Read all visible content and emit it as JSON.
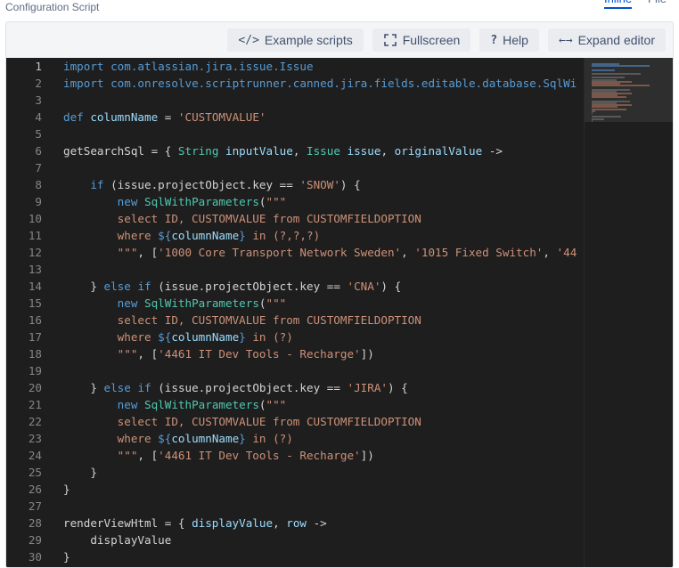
{
  "header": {
    "title": "Configuration Script",
    "tabs": [
      {
        "label": "Inline",
        "active": true
      },
      {
        "label": "File",
        "active": false
      }
    ]
  },
  "toolbar": {
    "example_scripts": "Example scripts",
    "fullscreen": "Fullscreen",
    "help": "Help",
    "expand_editor": "Expand editor"
  },
  "editor": {
    "current_line": 1,
    "colors": {
      "background": "#1e1e1e",
      "keyword": "#569cd6",
      "type": "#4ec9b0",
      "string": "#ce9178",
      "identifier": "#9cdcfe",
      "text": "#d4d4d4",
      "line_number": "#858585"
    },
    "lines": [
      {
        "n": "1",
        "tokens": [
          [
            "kw",
            "import"
          ],
          [
            "pun",
            " "
          ],
          [
            "kw",
            "com.atlassian.jira.issue.Issue"
          ]
        ]
      },
      {
        "n": "2",
        "tokens": [
          [
            "kw",
            "import"
          ],
          [
            "pun",
            " "
          ],
          [
            "kw",
            "com.onresolve.scriptrunner.canned.jira.fields.editable.database.SqlWi"
          ]
        ]
      },
      {
        "n": "3",
        "tokens": []
      },
      {
        "n": "4",
        "tokens": [
          [
            "kw",
            "def"
          ],
          [
            "pun",
            " "
          ],
          [
            "id",
            "columnName"
          ],
          [
            "pun",
            " = "
          ],
          [
            "str",
            "'CUSTOMVALUE'"
          ]
        ]
      },
      {
        "n": "5",
        "tokens": []
      },
      {
        "n": "6",
        "tokens": [
          [
            "pun",
            "getSearchSql = { "
          ],
          [
            "ty",
            "String"
          ],
          [
            "pun",
            " "
          ],
          [
            "id",
            "inputValue"
          ],
          [
            "pun",
            ", "
          ],
          [
            "ty",
            "Issue"
          ],
          [
            "pun",
            " "
          ],
          [
            "id",
            "issue"
          ],
          [
            "pun",
            ", "
          ],
          [
            "id",
            "originalValue"
          ],
          [
            "pun",
            " ->"
          ]
        ]
      },
      {
        "n": "7",
        "tokens": []
      },
      {
        "n": "8",
        "tokens": [
          [
            "pun",
            "    "
          ],
          [
            "kw",
            "if"
          ],
          [
            "pun",
            " (issue.projectObject.key == "
          ],
          [
            "str",
            "'SNOW'"
          ],
          [
            "pun",
            ") {"
          ]
        ]
      },
      {
        "n": "9",
        "tokens": [
          [
            "pun",
            "        "
          ],
          [
            "kw",
            "new"
          ],
          [
            "pun",
            " "
          ],
          [
            "ty",
            "SqlWithParameters"
          ],
          [
            "pun",
            "("
          ],
          [
            "str",
            "\"\"\""
          ]
        ]
      },
      {
        "n": "10",
        "tokens": [
          [
            "str",
            "        select ID, CUSTOMVALUE from CUSTOMFIELDOPTION"
          ]
        ]
      },
      {
        "n": "11",
        "tokens": [
          [
            "str",
            "        where "
          ],
          [
            "kw",
            "${"
          ],
          [
            "id",
            "columnName"
          ],
          [
            "kw",
            "}"
          ],
          [
            "str",
            " in (?,?,?)"
          ]
        ]
      },
      {
        "n": "12",
        "tokens": [
          [
            "str",
            "        \"\"\""
          ],
          [
            "pun",
            ", ["
          ],
          [
            "str",
            "'1000 Core Transport Network Sweden'"
          ],
          [
            "pun",
            ", "
          ],
          [
            "str",
            "'1015 Fixed Switch'"
          ],
          [
            "pun",
            ", "
          ],
          [
            "str",
            "'44"
          ]
        ]
      },
      {
        "n": "13",
        "tokens": []
      },
      {
        "n": "14",
        "tokens": [
          [
            "pun",
            "    } "
          ],
          [
            "kw",
            "else"
          ],
          [
            "pun",
            " "
          ],
          [
            "kw",
            "if"
          ],
          [
            "pun",
            " (issue.projectObject.key == "
          ],
          [
            "str",
            "'CNA'"
          ],
          [
            "pun",
            ") {"
          ]
        ]
      },
      {
        "n": "15",
        "tokens": [
          [
            "pun",
            "        "
          ],
          [
            "kw",
            "new"
          ],
          [
            "pun",
            " "
          ],
          [
            "ty",
            "SqlWithParameters"
          ],
          [
            "pun",
            "("
          ],
          [
            "str",
            "\"\"\""
          ]
        ]
      },
      {
        "n": "16",
        "tokens": [
          [
            "str",
            "        select ID, CUSTOMVALUE from CUSTOMFIELDOPTION"
          ]
        ]
      },
      {
        "n": "17",
        "tokens": [
          [
            "str",
            "        where "
          ],
          [
            "kw",
            "${"
          ],
          [
            "id",
            "columnName"
          ],
          [
            "kw",
            "}"
          ],
          [
            "str",
            " in (?)"
          ]
        ]
      },
      {
        "n": "18",
        "tokens": [
          [
            "str",
            "        \"\"\""
          ],
          [
            "pun",
            ", ["
          ],
          [
            "str",
            "'4461 IT Dev Tools - Recharge'"
          ],
          [
            "pun",
            "])"
          ]
        ]
      },
      {
        "n": "19",
        "tokens": []
      },
      {
        "n": "20",
        "tokens": [
          [
            "pun",
            "    } "
          ],
          [
            "kw",
            "else"
          ],
          [
            "pun",
            " "
          ],
          [
            "kw",
            "if"
          ],
          [
            "pun",
            " (issue.projectObject.key == "
          ],
          [
            "str",
            "'JIRA'"
          ],
          [
            "pun",
            ") {"
          ]
        ]
      },
      {
        "n": "21",
        "tokens": [
          [
            "pun",
            "        "
          ],
          [
            "kw",
            "new"
          ],
          [
            "pun",
            " "
          ],
          [
            "ty",
            "SqlWithParameters"
          ],
          [
            "pun",
            "("
          ],
          [
            "str",
            "\"\"\""
          ]
        ]
      },
      {
        "n": "22",
        "tokens": [
          [
            "str",
            "        select ID, CUSTOMVALUE from CUSTOMFIELDOPTION"
          ]
        ]
      },
      {
        "n": "23",
        "tokens": [
          [
            "str",
            "        where "
          ],
          [
            "kw",
            "${"
          ],
          [
            "id",
            "columnName"
          ],
          [
            "kw",
            "}"
          ],
          [
            "str",
            " in (?)"
          ]
        ]
      },
      {
        "n": "24",
        "tokens": [
          [
            "str",
            "        \"\"\""
          ],
          [
            "pun",
            ", ["
          ],
          [
            "str",
            "'4461 IT Dev Tools - Recharge'"
          ],
          [
            "pun",
            "])"
          ]
        ]
      },
      {
        "n": "25",
        "tokens": [
          [
            "pun",
            "    }"
          ]
        ]
      },
      {
        "n": "26",
        "tokens": [
          [
            "pun",
            "}"
          ]
        ]
      },
      {
        "n": "27",
        "tokens": []
      },
      {
        "n": "28",
        "tokens": [
          [
            "pun",
            "renderViewHtml = { "
          ],
          [
            "id",
            "displayValue"
          ],
          [
            "pun",
            ", "
          ],
          [
            "id",
            "row"
          ],
          [
            "pun",
            " ->"
          ]
        ]
      },
      {
        "n": "29",
        "tokens": [
          [
            "pun",
            "    displayValue"
          ]
        ]
      },
      {
        "n": "30",
        "tokens": [
          [
            "pun",
            "}"
          ]
        ]
      }
    ]
  }
}
